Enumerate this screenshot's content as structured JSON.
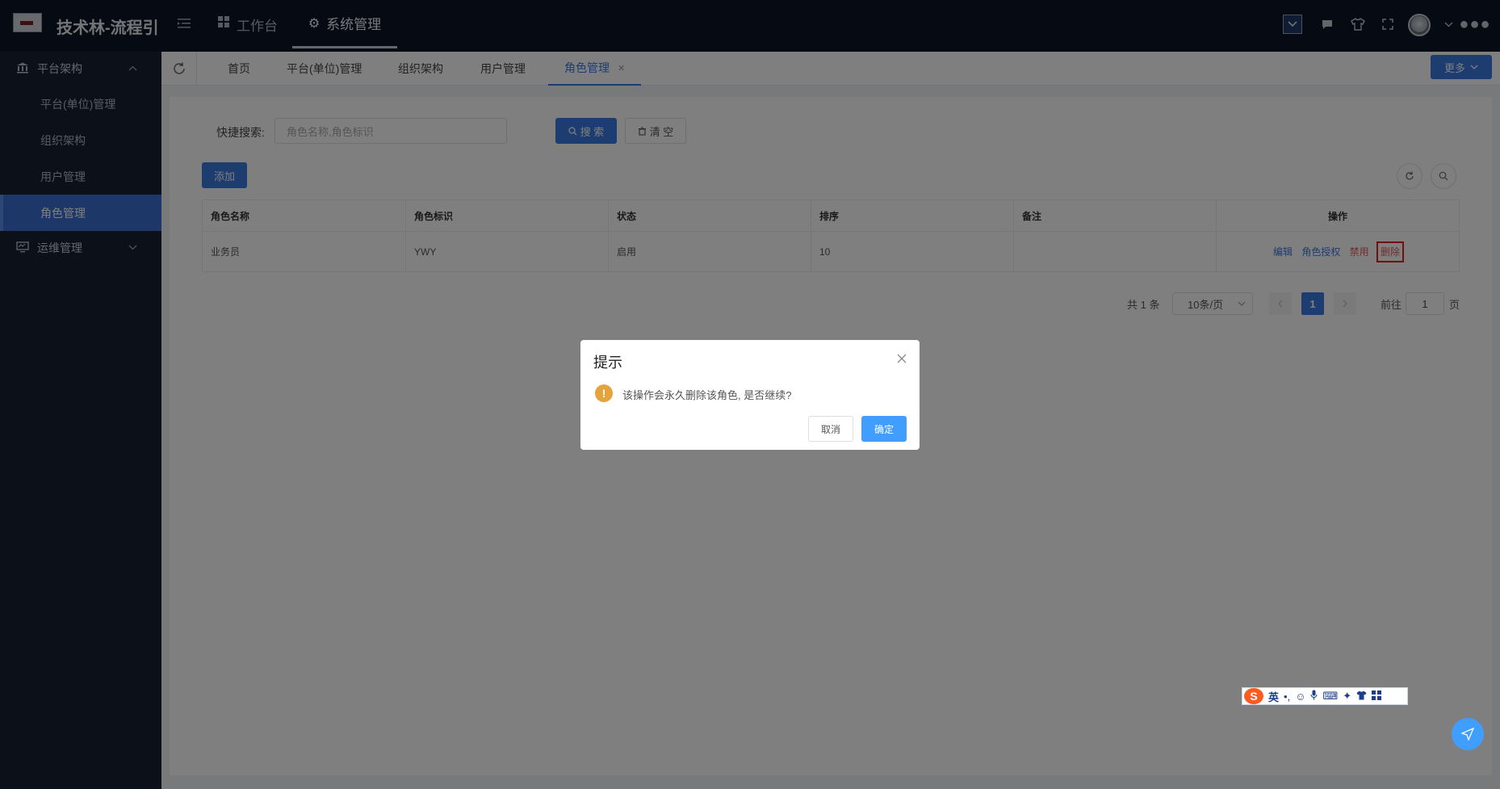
{
  "header": {
    "app_title": "技术林-流程引",
    "nav": [
      {
        "label": "工作台",
        "icon": "grid-icon"
      },
      {
        "label": "系统管理",
        "icon": "gear-icon"
      }
    ]
  },
  "sidebar": {
    "groups": [
      {
        "label": "平台架构",
        "icon": "bank-icon",
        "expanded": true,
        "items": [
          {
            "label": "平台(单位)管理"
          },
          {
            "label": "组织架构"
          },
          {
            "label": "用户管理"
          },
          {
            "label": "角色管理",
            "active": true
          }
        ]
      },
      {
        "label": "运维管理",
        "icon": "monitor-icon",
        "expanded": false
      }
    ]
  },
  "tabs": {
    "items": [
      {
        "label": "首页"
      },
      {
        "label": "平台(单位)管理"
      },
      {
        "label": "组织架构"
      },
      {
        "label": "用户管理"
      },
      {
        "label": "角色管理",
        "active": true
      }
    ],
    "more_label": "更多"
  },
  "search": {
    "label": "快捷搜索:",
    "placeholder": "角色名称,角色标识",
    "search_label": "搜 索",
    "clear_label": "清 空"
  },
  "toolbar": {
    "add_label": "添加"
  },
  "table": {
    "columns": [
      "角色名称",
      "角色标识",
      "状态",
      "排序",
      "备注",
      "操作"
    ],
    "rows": [
      {
        "name": "业务员",
        "code": "YWY",
        "status": "启用",
        "order": "10",
        "remark": "",
        "ops": [
          "编辑",
          "角色授权",
          "禁用",
          "删除"
        ]
      }
    ]
  },
  "pagination": {
    "total_text": "共 1 条",
    "page_size": "10条/页",
    "current_page": "1",
    "goto_label": "前往",
    "goto_value": "1",
    "page_suffix": "页"
  },
  "dialog": {
    "title": "提示",
    "message": "该操作会永久删除该角色, 是否继续?",
    "cancel_label": "取消",
    "confirm_label": "确定"
  },
  "ime": {
    "lang": "英"
  },
  "colors": {
    "primary": "#3a78e0",
    "danger": "#e05a5a",
    "success": "#3aa657",
    "header_bg": "#0c1526",
    "sidebar_bg": "#172033"
  }
}
